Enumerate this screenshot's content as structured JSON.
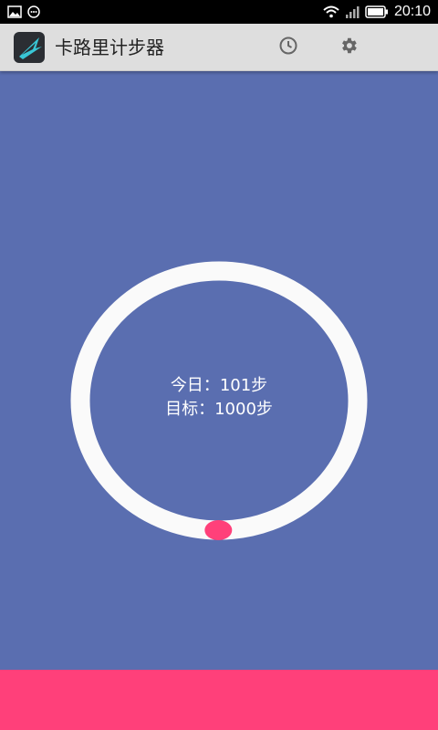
{
  "status_bar": {
    "time": "20:10",
    "icons_left": [
      "image-icon",
      "message-icon"
    ],
    "icons_right": [
      "wifi-icon",
      "signal-icon",
      "battery-icon"
    ]
  },
  "app_bar": {
    "title": "卡路里计步器",
    "actions": [
      "history-icon",
      "settings-icon"
    ]
  },
  "progress": {
    "today_label": "今日：",
    "today_value": "101步",
    "goal_label": "目标：",
    "goal_value": "1000步",
    "fraction": 0.101
  },
  "colors": {
    "background": "#5a6eb0",
    "ring": "#fafafa",
    "indicator": "#ff407a",
    "app_bar": "#dedede",
    "bottom_bar": "#ff407a"
  }
}
